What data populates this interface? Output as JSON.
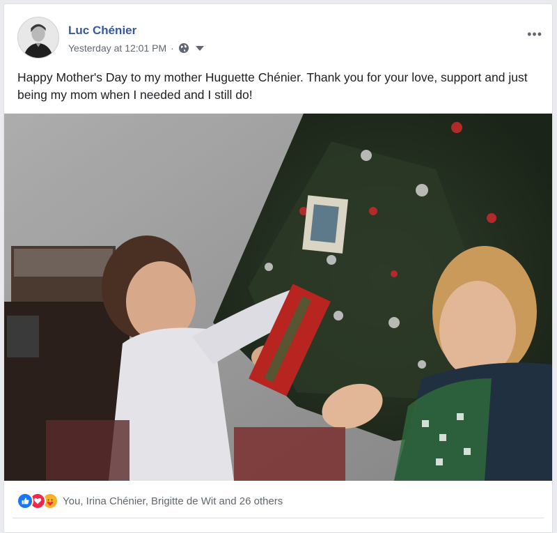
{
  "post": {
    "author": "Luc Chénier",
    "timestamp": "Yesterday at 12:01 PM",
    "separator": "·",
    "privacy_icon": "globe-icon",
    "text": "Happy Mother's Day to my mother Huguette Chénier. Thank you for your love, support and just being my mom when I needed and I still do!",
    "more_icon": "more-options-icon"
  },
  "reactions": {
    "icons": [
      "like-icon",
      "love-icon",
      "care-icon"
    ],
    "summary": "You, Irina Chénier, Brigitte de Wit and 26 others"
  },
  "colors": {
    "author_link": "#385898",
    "meta_text": "#606770",
    "like": "#1877f2",
    "love": "#f0284a",
    "care": "#f7b125"
  }
}
